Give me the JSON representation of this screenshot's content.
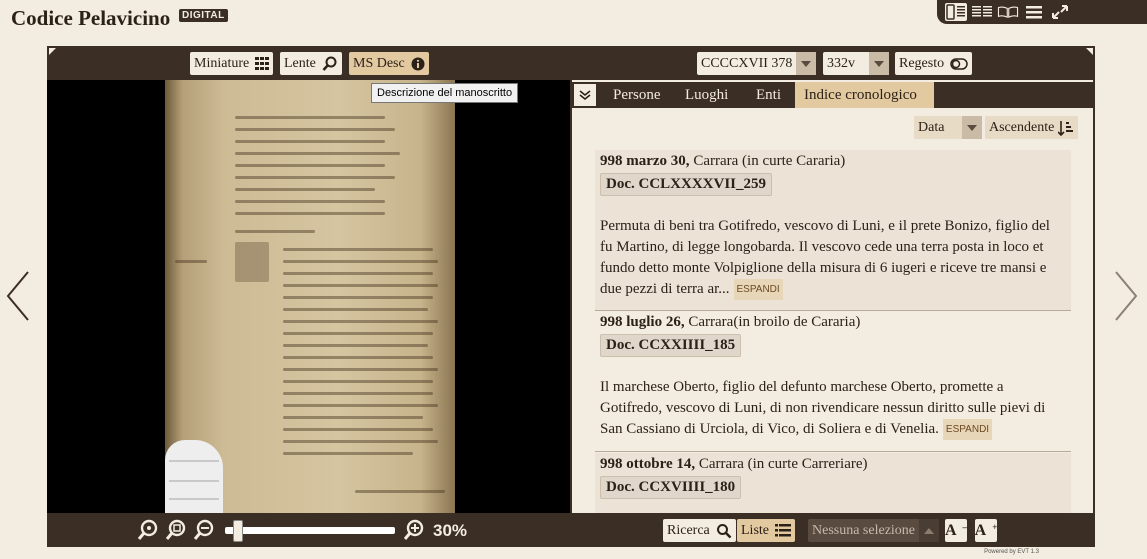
{
  "app": {
    "title": "Codice Pelavicino",
    "badge": "DIGITAL"
  },
  "view_modes": [
    {
      "icon": "image-text-view-icon",
      "active": true
    },
    {
      "icon": "text-text-view-icon",
      "active": false
    },
    {
      "icon": "book-view-icon",
      "active": false
    },
    {
      "icon": "menu-icon",
      "active": false
    },
    {
      "icon": "fullscreen-icon",
      "active": false
    }
  ],
  "left_toolbar": {
    "thumbnails": "Miniature",
    "lens": "Lente",
    "ms_desc": "MS Desc"
  },
  "tooltip": "Descrizione del manoscritto",
  "right_toolbar": {
    "document": "CCCCXVII 378",
    "page": "332v",
    "regesto": "Regesto"
  },
  "tabs": [
    {
      "label": "Persone",
      "active": false
    },
    {
      "label": "Luoghi",
      "active": false
    },
    {
      "label": "Enti",
      "active": false
    },
    {
      "label": "Indice cronologico",
      "active": true
    }
  ],
  "sort": {
    "field": "Data",
    "order": "Ascendente"
  },
  "entries": [
    {
      "date": "998 marzo 30,",
      "place": "Carrara (in curte Cararia)",
      "doc": "Doc. CCLXXXXVII_259",
      "text": "Permuta di beni tra Gotifredo, vescovo di Luni, e il prete Bonizo, figlio del fu Martino, di legge longobarda. Il vescovo cede una terra posta in loco et fundo detto monte Volpiglione della misura di 6 iugeri e riceve tre mansi e due pezzi di terra ar...",
      "expand": "ESPANDI"
    },
    {
      "date": "998 luglio 26,",
      "place": "Carrara(in broilo de Cararia)",
      "doc": "Doc. CCXXIIII_185",
      "text": "Il marchese Oberto, figlio del defunto marchese Oberto, promette a Gotifredo, vescovo di Luni, di non rivendicare nessun diritto sulle pievi di San Cassiano di Urciola, di Vico, di Soliera e di Venelia.",
      "expand": "ESPANDI"
    },
    {
      "date": "998 ottobre 14,",
      "place": "Carrara (in curte Carreriare)",
      "doc": "Doc. CCXVIIII_180"
    }
  ],
  "zoom": {
    "level": "30%",
    "fraction": 0.05
  },
  "bottom_right": {
    "search": "Ricerca",
    "lists": "Liste",
    "selection": "Nessuna selezione",
    "font_decrease": "A",
    "font_increase": "A"
  },
  "footer": "Powered by EVT 1.3",
  "colors": {
    "dark": "#3b2e25",
    "paper": "#f3ece0",
    "accent": "#e3c9a0"
  }
}
